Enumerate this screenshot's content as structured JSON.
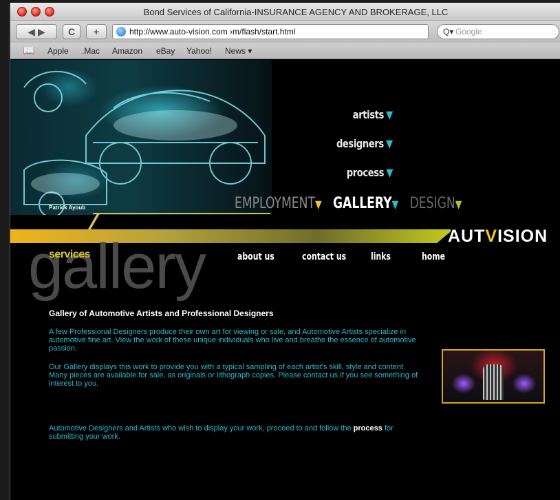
{
  "browser": {
    "title": "Bond Services of California-INSURANCE AGENCY AND BROKERAGE, LLC",
    "url": "http://www.auto-vision.com ›m/flash/start.html",
    "search_placeholder": "Google",
    "back_glyph": "◀ ▶",
    "reload_glyph": "C",
    "add_glyph": "+",
    "bookmarks": [
      "Apple",
      ".Mac",
      "Amazon",
      "eBay",
      "Yahoo!",
      "News ▾"
    ]
  },
  "hero": {
    "credit": "Patrick Ayoub"
  },
  "side_nav": {
    "items": [
      "artists",
      "designers",
      "process"
    ],
    "tri": "▼"
  },
  "section_tabs": {
    "employment": "EMPLOYMENT",
    "gallery": "GALLERY",
    "design": "DESIGN",
    "tri": "▼"
  },
  "brand": {
    "pre": "AUT",
    "v": "V",
    "post": "ISION"
  },
  "top_nav": {
    "services": "services",
    "about": "about us",
    "contact": "contact us",
    "links": "links",
    "home": "home"
  },
  "watermark": "gallery",
  "content": {
    "heading": "Gallery of Automotive Artists and Professional Designers",
    "para1": "A few Professional Designers produce their own art for viewing or sale, and Automotive Artists specialize in automotive fine art. View the work of these unique individuals who live and breathe the essence of automotive passion.",
    "para2": "Our Gallery displays this work to provide you with a typical sampling of each artist's skill, style and content. Many pieces are available for sale, as originals or lithograph copies. Please contact us if you see something of interest to you.",
    "para3_pre": "Automotive Designers and Artists who wish to display your work, proceed to and follow the",
    "para3_link": "process",
    "para3_post": "for submitting your work."
  },
  "colors": {
    "accent_cyan": "#2fb8d0",
    "accent_gold": "#f0b31a",
    "services_green": "#d4c62a"
  }
}
